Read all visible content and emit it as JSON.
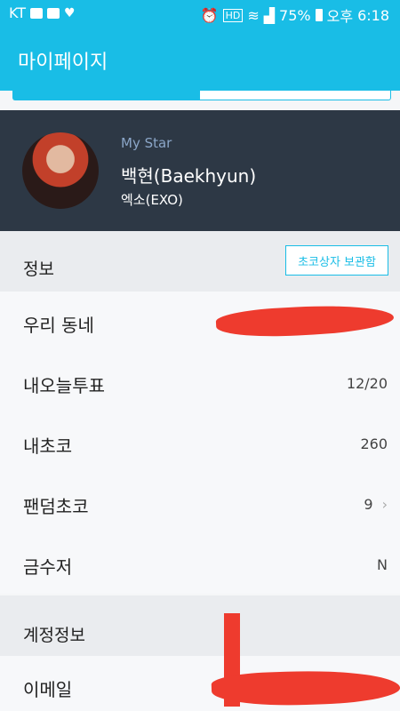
{
  "status_bar": {
    "carrier": "KT",
    "battery": "75%",
    "ampm": "오후",
    "time": "6:18"
  },
  "header": {
    "title": "마이페이지"
  },
  "profile": {
    "section_label": "My Star",
    "name": "백현(Baekhyun)",
    "group": "엑소(EXO)"
  },
  "info_section": {
    "title": "정보",
    "action_label": "초코상자 보관함"
  },
  "rows": [
    {
      "label": "우리 동네",
      "value": ""
    },
    {
      "label": "내오늘투표",
      "value": "12/20"
    },
    {
      "label": "내초코",
      "value": "260"
    },
    {
      "label": "팬덤초코",
      "value": "9"
    },
    {
      "label": "금수저",
      "value": "N"
    }
  ],
  "account_section": {
    "title": "계정정보"
  },
  "account_rows": [
    {
      "label": "이메일",
      "value": ""
    }
  ],
  "colors": {
    "accent": "#19bde6",
    "profile_bg": "#2d3845",
    "redaction": "#ee3b2e"
  }
}
